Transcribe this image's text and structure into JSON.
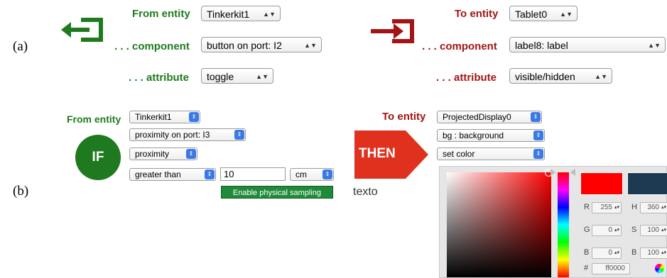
{
  "panel_a": {
    "label": "(a)",
    "from": {
      "entity_label": "From entity",
      "entity_value": "Tinkerkit1",
      "component_label": ". . . component",
      "component_value": "button on port: I2",
      "attribute_label": ". . . attribute",
      "attribute_value": "toggle"
    },
    "to": {
      "entity_label": "To entity",
      "entity_value": "Tablet0",
      "component_label": ". . . component",
      "component_value": "label8: label",
      "attribute_label": ". . . attribute",
      "attribute_value": "visible/hidden"
    }
  },
  "panel_b": {
    "label": "(b)",
    "if": {
      "badge": "IF",
      "entity_label": "From entity",
      "entity_value": "Tinkerkit1",
      "component_value": "proximity on port: I3",
      "attribute_value": "proximity",
      "operator_value": "greater than",
      "threshold_value": "10",
      "unit_value": "cm",
      "sampling_button": "Enable physical sampling"
    },
    "then": {
      "badge": "THEN",
      "caption": "texto",
      "entity_label": "To entity",
      "entity_value": "ProjectedDisplay0",
      "component_value": "bg : background",
      "action_value": "set color"
    },
    "color_picker": {
      "selected_color": "#ff0000",
      "rgb": {
        "r_label": "R",
        "r": "255",
        "g_label": "G",
        "g": "0",
        "b_label": "B",
        "b": "0"
      },
      "hsb": {
        "h_label": "H",
        "h": "360",
        "s_label": "S",
        "s": "100",
        "b_label": "B",
        "b": "100"
      },
      "hex_label": "#",
      "hex": "ff0000"
    }
  },
  "colors": {
    "green": "#1f7a1f",
    "red": "#a31515",
    "accent_blue": "#3b7ae6"
  },
  "icons": [
    "exit-arrow-icon",
    "enter-arrow-icon",
    "color-wheel-icon"
  ]
}
